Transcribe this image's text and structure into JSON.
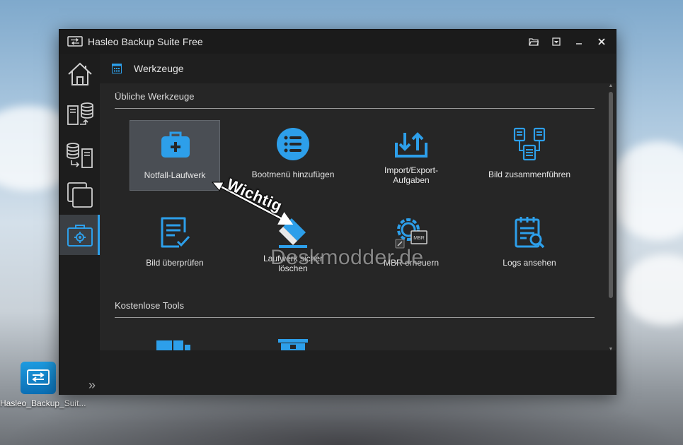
{
  "window": {
    "title": "Hasleo Backup Suite Free"
  },
  "header": {
    "title": "Werkzeuge",
    "icon": "tools-grid-icon"
  },
  "sidebar": {
    "items": [
      {
        "name": "home",
        "icon": "home-icon",
        "active": false
      },
      {
        "name": "backup",
        "icon": "backup-icon",
        "active": false
      },
      {
        "name": "restore",
        "icon": "restore-icon",
        "active": false
      },
      {
        "name": "clone",
        "icon": "clone-icon",
        "active": false
      },
      {
        "name": "tools",
        "icon": "toolbox-icon",
        "active": true
      }
    ],
    "expand_label": "»"
  },
  "sections": {
    "common": {
      "title": "Übliche Werkzeuge",
      "tools": [
        {
          "label": "Notfall-Laufwerk",
          "icon": "medical-kit-icon",
          "selected": true
        },
        {
          "label": "Bootmenü hinzufügen",
          "icon": "list-icon"
        },
        {
          "label": "Import/Export-Aufgaben",
          "icon": "import-export-icon"
        },
        {
          "label": "Bild zusammenführen",
          "icon": "merge-images-icon"
        },
        {
          "label": "Bild überprüfen",
          "icon": "check-document-icon"
        },
        {
          "label": "Laufwerk sicher löschen",
          "icon": "eraser-icon"
        },
        {
          "label": "MBR erneuern",
          "icon": "mbr-gear-icon"
        },
        {
          "label": "Logs ansehen",
          "icon": "logs-icon"
        }
      ]
    },
    "free": {
      "title": "Kostenlose Tools"
    }
  },
  "annotation": {
    "text": "Wichtig"
  },
  "watermark": "Deskmodder.de",
  "desktop": {
    "icon_label": "Hasleo_Backup_Suit..."
  },
  "colors": {
    "accent": "#2d9fea",
    "window_bg": "#262626",
    "titlebar_bg": "#1b1b1b",
    "sidebar_bg": "#1d1d1d"
  }
}
